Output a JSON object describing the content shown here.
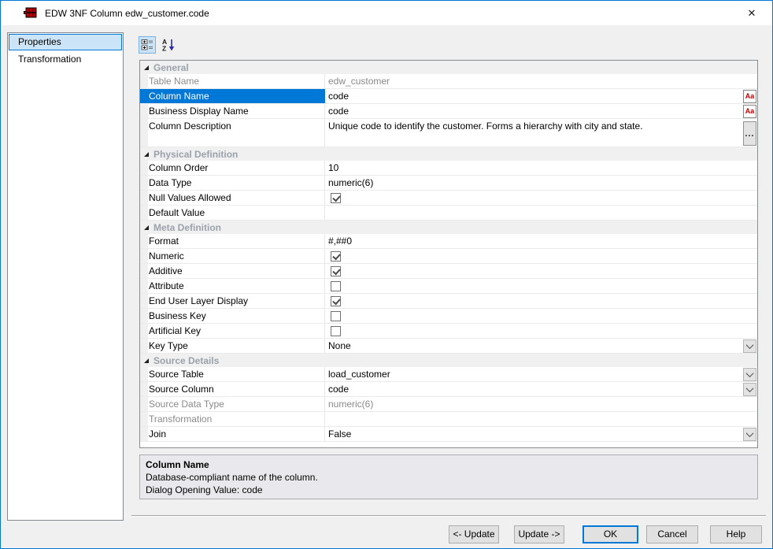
{
  "window": {
    "title": "EDW 3NF Column edw_customer.code"
  },
  "tabs": [
    {
      "label": "Properties",
      "selected": true
    },
    {
      "label": "Transformation",
      "selected": false
    }
  ],
  "toolbar": {
    "categorized_button": "categorized-view",
    "alphabetical_button": "alphabetical-sort"
  },
  "grid": {
    "sections": [
      {
        "title": "General",
        "rows": [
          {
            "label": "Table Name",
            "type": "text",
            "value": "edw_customer",
            "disabled": true
          },
          {
            "label": "Column Name",
            "type": "text",
            "value": "code",
            "selected": true,
            "button": "rename"
          },
          {
            "label": "Business Display Name",
            "type": "text",
            "value": "code",
            "button": "rename"
          },
          {
            "label": "Column Description",
            "type": "text",
            "value": "Unique code to identify the customer. Forms a hierarchy with city and state.",
            "button": "ellipsis",
            "tall": true
          }
        ]
      },
      {
        "title": "Physical Definition",
        "rows": [
          {
            "label": "Column Order",
            "type": "text",
            "value": "10"
          },
          {
            "label": "Data Type",
            "type": "text",
            "value": "numeric(6)"
          },
          {
            "label": "Null Values Allowed",
            "type": "checkbox",
            "checked": true
          },
          {
            "label": "Default Value",
            "type": "text",
            "value": ""
          }
        ]
      },
      {
        "title": "Meta Definition",
        "rows": [
          {
            "label": "Format",
            "type": "text",
            "value": "#,##0"
          },
          {
            "label": "Numeric",
            "type": "checkbox",
            "checked": true
          },
          {
            "label": "Additive",
            "type": "checkbox",
            "checked": true
          },
          {
            "label": "Attribute",
            "type": "checkbox",
            "checked": false
          },
          {
            "label": "End User Layer Display",
            "type": "checkbox",
            "checked": true
          },
          {
            "label": "Business Key",
            "type": "checkbox",
            "checked": false
          },
          {
            "label": "Artificial Key",
            "type": "checkbox",
            "checked": false
          },
          {
            "label": "Key Type",
            "type": "text",
            "value": "None",
            "button": "dropdown"
          }
        ]
      },
      {
        "title": "Source Details",
        "rows": [
          {
            "label": "Source Table",
            "type": "text",
            "value": "load_customer",
            "button": "dropdown"
          },
          {
            "label": "Source Column",
            "type": "text",
            "value": "code",
            "button": "dropdown"
          },
          {
            "label": "Source Data Type",
            "type": "text",
            "value": "numeric(6)",
            "disabled": true
          },
          {
            "label": "Transformation",
            "type": "text",
            "value": "",
            "disabled": true
          },
          {
            "label": "Join",
            "type": "text",
            "value": "False",
            "button": "dropdown"
          }
        ]
      }
    ]
  },
  "help": {
    "title": "Column Name",
    "lines": [
      "Database-compliant name of the column.",
      "Dialog Opening Value: code"
    ]
  },
  "footer": {
    "buttons": [
      {
        "label": "<- Update",
        "name": "update-left-button"
      },
      {
        "label": "Update ->",
        "name": "update-right-button"
      },
      {
        "label": "OK",
        "name": "ok-button",
        "default": true
      },
      {
        "label": "Cancel",
        "name": "cancel-button"
      },
      {
        "label": "Help",
        "name": "help-button"
      }
    ]
  },
  "icons": {
    "app_icon": "red-table-grid-icon",
    "close_glyph": "✕",
    "rename_glyph": "Aa",
    "ellipsis_glyph": "...",
    "dropdown_icon": "chevron-down-icon",
    "checkbox_icon": "checkmark-icon"
  },
  "colors": {
    "accent": "#0078d7",
    "selected_row": "#0078d7",
    "category_text": "#9aa2ab",
    "rename_red": "#c00000",
    "body_bg": "#f0f0f0",
    "help_bg": "#e9e9ed"
  }
}
